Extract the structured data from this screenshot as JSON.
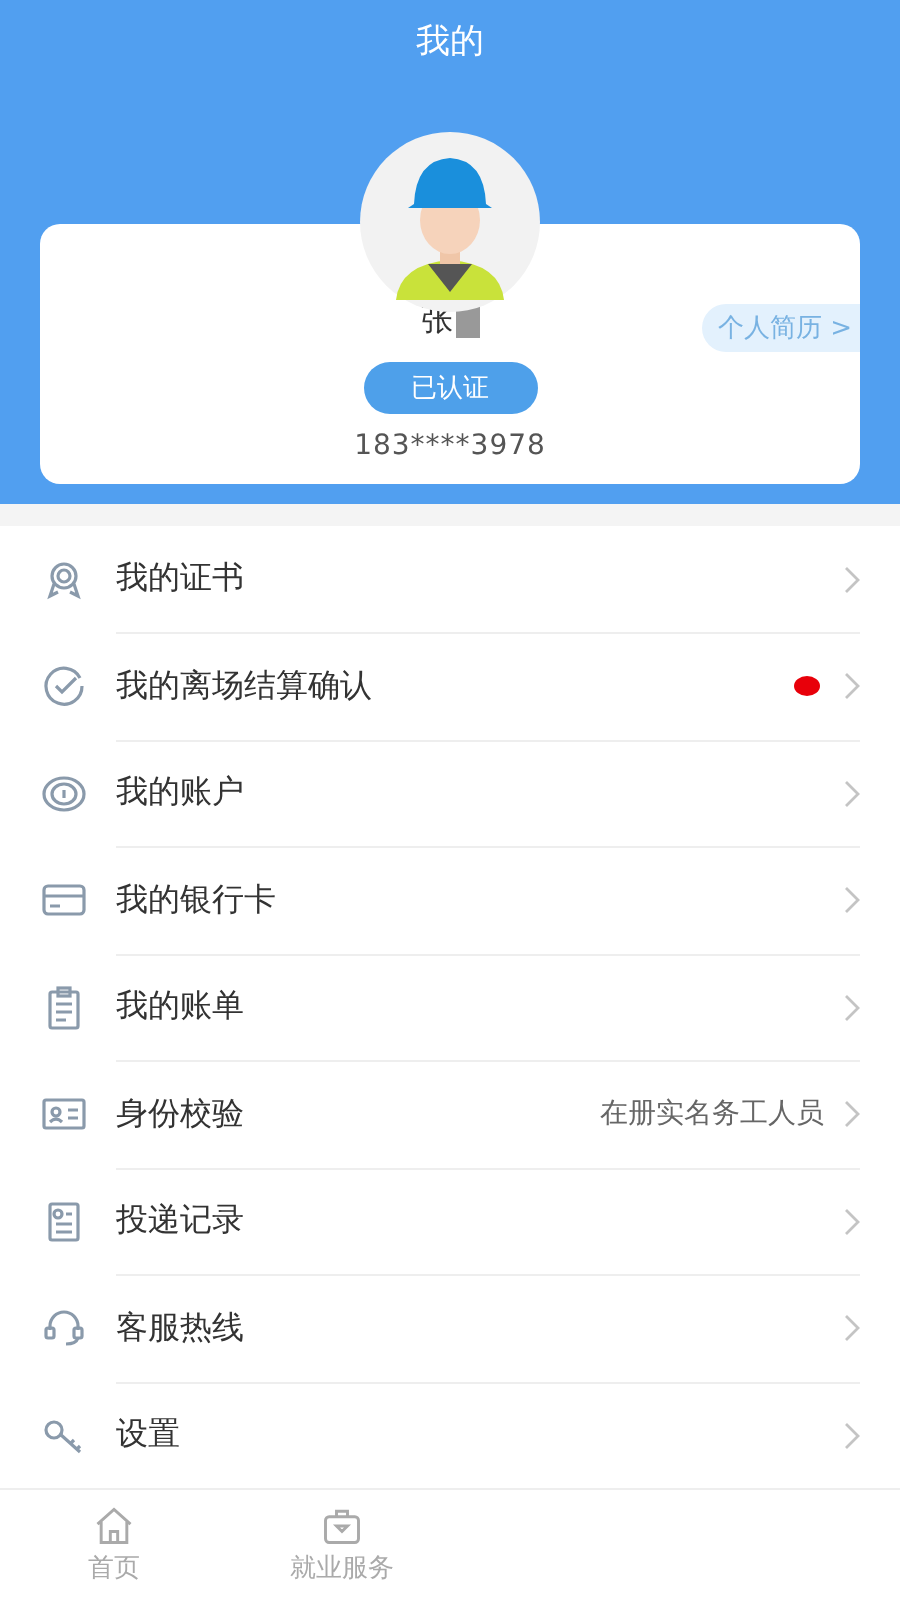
{
  "header": {
    "title": "我的"
  },
  "profile": {
    "name": "张",
    "verified_badge": "已认证",
    "phone": "183****3978",
    "resume_link": "个人简历 >"
  },
  "menu": [
    {
      "label": "我的证书",
      "unread": false
    },
    {
      "label": "我的离场结算确认",
      "unread": true
    },
    {
      "label": "我的账户",
      "unread": false
    },
    {
      "label": "我的银行卡",
      "unread": false
    },
    {
      "label": "我的账单",
      "unread": false
    },
    {
      "label": "身份校验",
      "value": "在册实名务工人员",
      "unread": false
    },
    {
      "label": "投递记录",
      "unread": false
    },
    {
      "label": "客服热线",
      "unread": false
    },
    {
      "label": "设置",
      "unread": false
    }
  ],
  "tab_bar": [
    {
      "label": "首页"
    },
    {
      "label": "就业服务"
    }
  ]
}
